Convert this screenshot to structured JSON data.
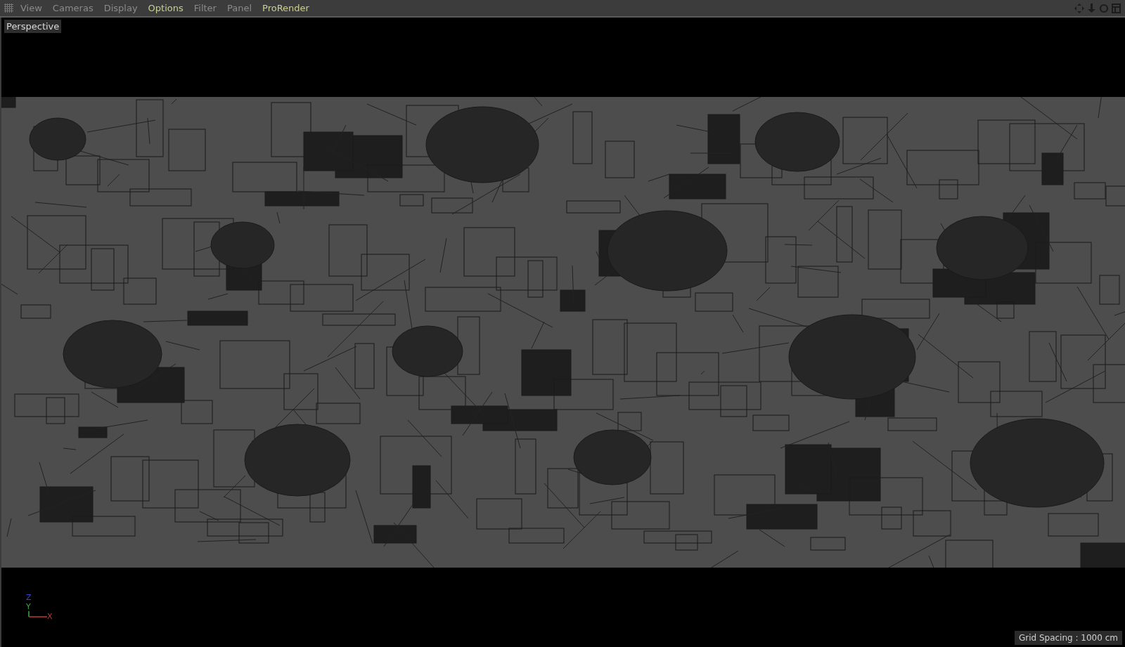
{
  "menu": [
    {
      "label": "View",
      "highlighted": false
    },
    {
      "label": "Cameras",
      "highlighted": false
    },
    {
      "label": "Display",
      "highlighted": false
    },
    {
      "label": "Options",
      "highlighted": true
    },
    {
      "label": "Filter",
      "highlighted": false
    },
    {
      "label": "Panel",
      "highlighted": false
    },
    {
      "label": "ProRender",
      "highlighted": true
    }
  ],
  "viewport": {
    "camera_label": "Perspective",
    "axes": [
      "Z",
      "Y",
      "X"
    ],
    "grid_spacing": "Grid Spacing : 1000 cm"
  }
}
